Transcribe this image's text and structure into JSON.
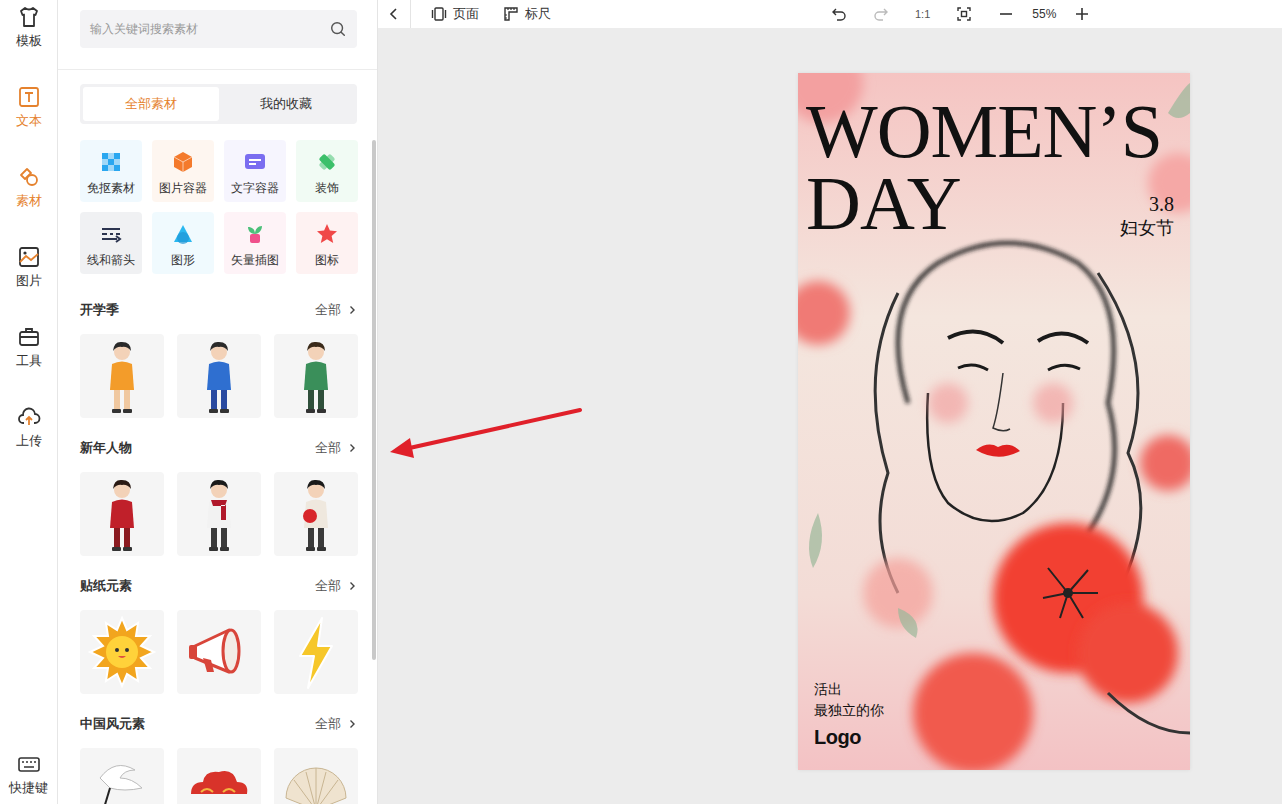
{
  "rail": {
    "items": [
      {
        "label": "模板",
        "selected": false,
        "highlighted": false
      },
      {
        "label": "文本",
        "selected": false,
        "highlighted": true
      },
      {
        "label": "素材",
        "selected": true,
        "highlighted": true
      },
      {
        "label": "图片",
        "selected": false,
        "highlighted": false
      },
      {
        "label": "工具",
        "selected": false,
        "highlighted": false
      },
      {
        "label": "上传",
        "selected": false,
        "highlighted": false
      }
    ],
    "footer": {
      "label": "快捷键"
    }
  },
  "search": {
    "placeholder": "输入关键词搜索素材"
  },
  "tabs": [
    {
      "label": "全部素材",
      "selected": true
    },
    {
      "label": "我的收藏",
      "selected": false
    }
  ],
  "categories": [
    {
      "label": "免抠素材",
      "color": "#2aa7f0"
    },
    {
      "label": "图片容器",
      "color": "#f47a2c"
    },
    {
      "label": "文字容器",
      "color": "#7a6df0"
    },
    {
      "label": "装饰",
      "color": "#3cc06a"
    },
    {
      "label": "线和箭头",
      "color": "#2c3550"
    },
    {
      "label": "图形",
      "color": "#2ab8f0"
    },
    {
      "label": "矢量插图",
      "color": "#f0508c"
    },
    {
      "label": "图标",
      "color": "#f04848"
    }
  ],
  "sections": [
    {
      "title": "开学季",
      "more": "全部",
      "items": [
        {
          "kind": "girl-walk"
        },
        {
          "kind": "boy-jump"
        },
        {
          "kind": "girl-books"
        }
      ]
    },
    {
      "title": "新年人物",
      "more": "全部",
      "items": [
        {
          "kind": "woman-red"
        },
        {
          "kind": "woman-scarf"
        },
        {
          "kind": "man-lantern"
        }
      ]
    },
    {
      "title": "贴纸元素",
      "more": "全部",
      "items": [
        {
          "kind": "sun"
        },
        {
          "kind": "megaphone"
        },
        {
          "kind": "bolt"
        }
      ]
    },
    {
      "title": "中国风元素",
      "more": "全部",
      "items": [
        {
          "kind": "crane"
        },
        {
          "kind": "cloud"
        },
        {
          "kind": "fan"
        }
      ]
    }
  ],
  "toolbar": {
    "page": "页面",
    "ruler": "标尺",
    "ratio": "1:1",
    "zoom": "55%"
  },
  "poster": {
    "title_line1": "WOMEN’S",
    "title_line2": "DAY",
    "date": "3.8",
    "holiday": "妇女节",
    "slogan_line1": "活出",
    "slogan_line2": "最独立的你",
    "logo": "Logo"
  }
}
